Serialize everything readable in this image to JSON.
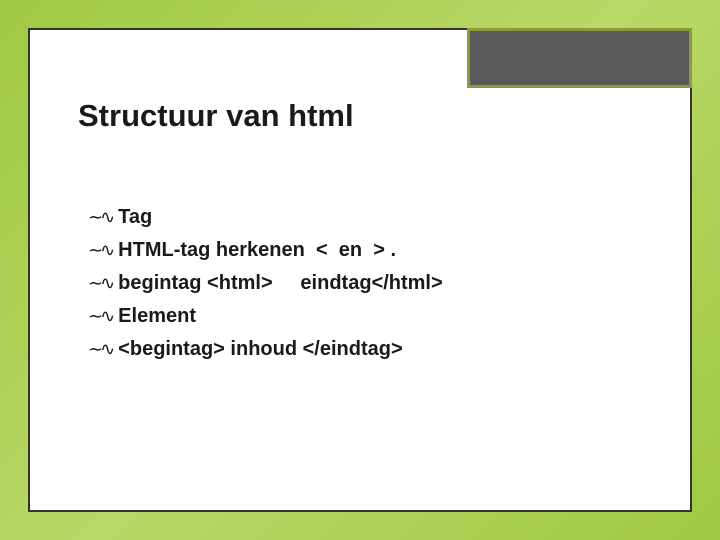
{
  "slide": {
    "title": "Structuur van html",
    "bullets": [
      {
        "text": "Tag"
      },
      {
        "text": "HTML-tag herkenen  <  en  > ."
      },
      {
        "text": "begintag <html>     eindtag</html>"
      },
      {
        "text": "Element"
      },
      {
        "text": "<begintag> inhoud </eindtag>"
      }
    ]
  }
}
